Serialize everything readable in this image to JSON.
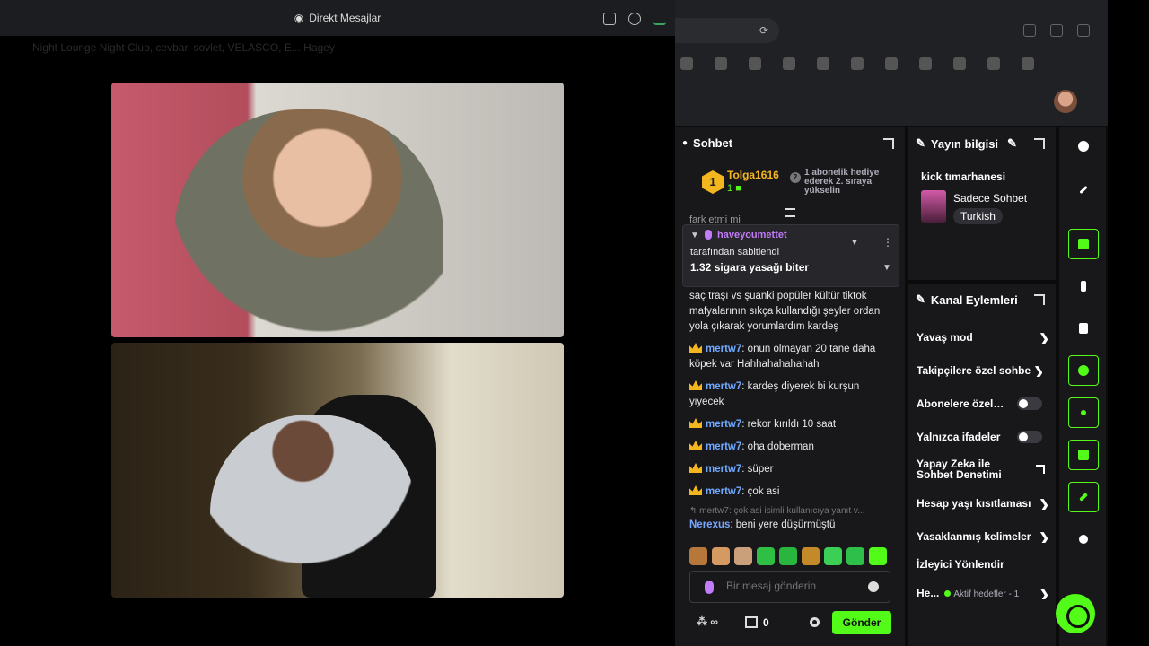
{
  "discord": {
    "title": "Direkt Mesajlar",
    "subtitle": "Night Lounge Night Club, cevbar, sovlet, VELASCO, E... Hagey"
  },
  "chat": {
    "title": "Sohbet",
    "gifter": {
      "name": "Tolga1616",
      "rank": "1",
      "count": "1",
      "cta_num": "2",
      "cta": "1 abonelik hediye ederek 2. sıraya yükselin"
    },
    "cutoff_line": "fark etmi mi",
    "pinned": {
      "user": "haveyoumettet",
      "by": "tarafından sabitlendi",
      "message": "1.32 sigara yasağı biter"
    },
    "messages": [
      {
        "user": "",
        "text": "saç traşı vs şuanki popüler kültür tiktok mafyalarının sıkça kullandığı şeyler ordan yola çıkarak yorumlardım kardeş"
      },
      {
        "user": "mertw7",
        "text": ": onun olmayan 20 tane daha köpek var Hahhahahahahah"
      },
      {
        "user": "mertw7",
        "text": ": kardeş diyerek bi kurşun yiyecek"
      },
      {
        "user": "mertw7",
        "text": ": rekor kırıldı 10 saat"
      },
      {
        "user": "mertw7",
        "text": ": oha doberman"
      },
      {
        "user": "mertw7",
        "text": ": süper"
      },
      {
        "user": "mertw7",
        "text": ": çok asi"
      }
    ],
    "reply_context": "mertw7: çok asi isimli kullanıcıya yanıt v...",
    "last": {
      "user": "Nerexus",
      "text": ": beni yere düşürmüştü"
    },
    "input_placeholder": "Bir mesaj gönderin",
    "points": "0",
    "send_label": "Gönder",
    "infinity": "∞"
  },
  "stream_info": {
    "title": "Yayın bilgisi",
    "channel": "kick tımarhanesi",
    "category": "Sadece Sohbet",
    "language": "Turkish"
  },
  "channel_actions": {
    "title": "Kanal Eylemleri",
    "slow": "Yavaş mod",
    "followers": "Takipçilere özel sohbet",
    "subs": "Abonelere özel sohbet",
    "emotes": "Yalnızca ifadeler",
    "ai": "Yapay Zeka ile Sohbet Denetimi",
    "age": "Hesap yaşı kısıtlaması",
    "banned": "Yasaklanmış kelimeler",
    "redirect": "İzleyici Yönlendir",
    "goals": "He...",
    "active_goals": "Aktif hedefler - 1"
  },
  "colors": {
    "kick_green": "#53fc18",
    "gold": "#f3b61f",
    "purple": "#c27cf7",
    "username_blue": "#6fa8ff"
  }
}
